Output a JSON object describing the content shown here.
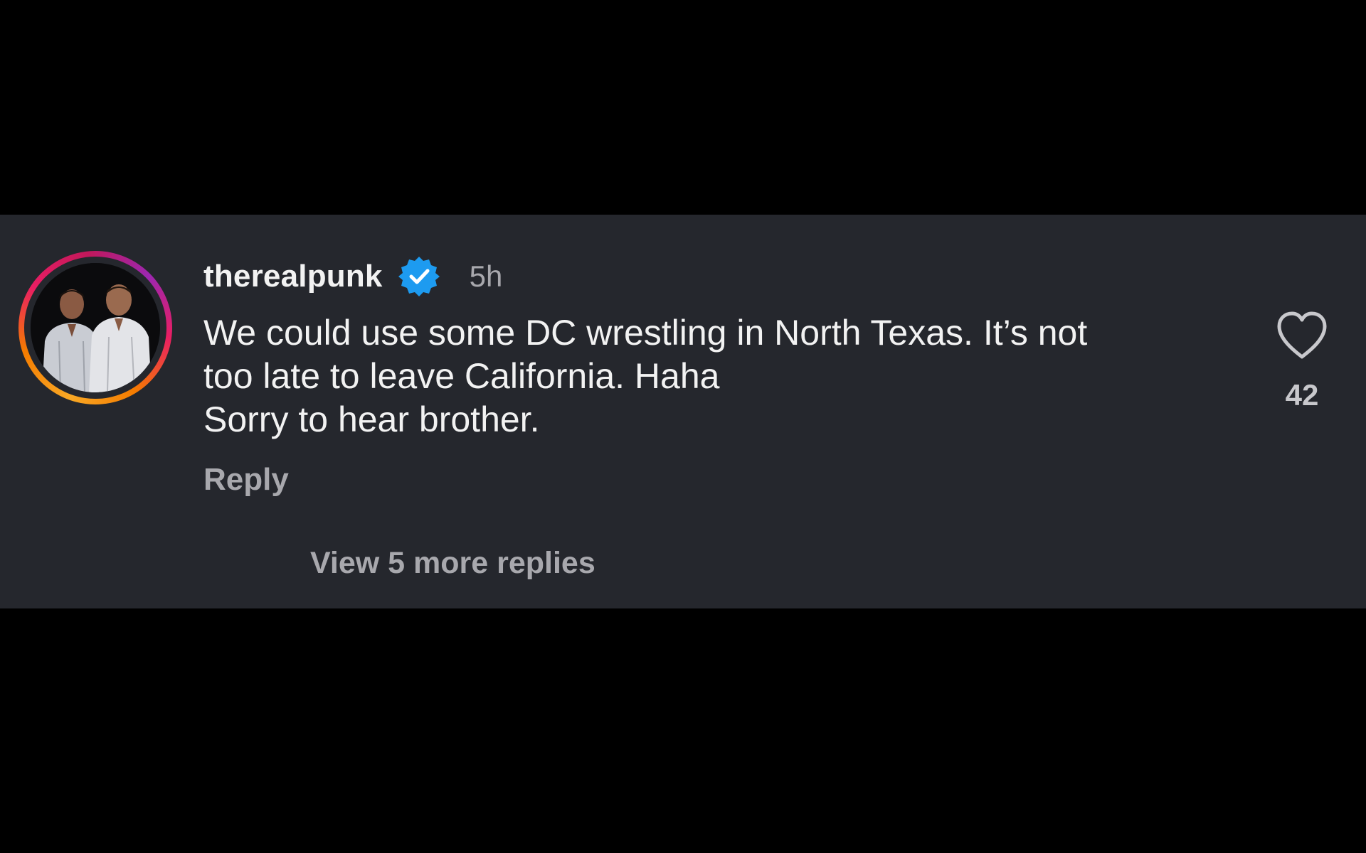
{
  "comment": {
    "username": "therealpunk",
    "verified": true,
    "timestamp": "5h",
    "text_lines": [
      "We could use some DC wrestling in North Texas. It’s not",
      "too late to leave California. Haha",
      "Sorry to hear brother."
    ],
    "reply_label": "Reply",
    "like_count": "42",
    "view_more_replies_label": "View 5 more replies"
  },
  "icons": {
    "verified": "verified-badge-icon",
    "like": "heart-outline-icon",
    "avatar": "avatar-photo"
  },
  "colors": {
    "background": "#000000",
    "panel": "#25272d",
    "primary_text": "#f2f2f2",
    "secondary_text": "#a8a8ad",
    "verified_blue": "#1d9bf0"
  }
}
